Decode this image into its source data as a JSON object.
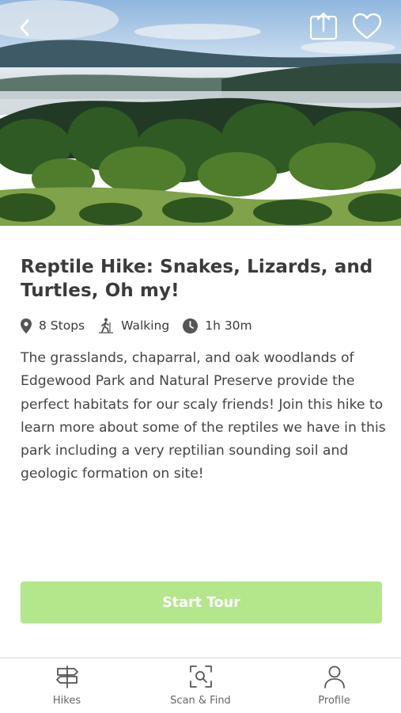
{
  "hero": {
    "back_icon": "chevron-left-icon",
    "share_icon": "share-icon",
    "favorite_icon": "heart-icon"
  },
  "tour": {
    "title": "Reptile Hike: Snakes, Lizards, and Turtles, Oh my!",
    "stops": "8 Stops",
    "mode": "Walking",
    "duration": "1h 30m",
    "description": "The grasslands, chaparral, and oak woodlands of Edgewood Park and Natural Preserve provide the perfect habitats for our scaly friends! Join this hike to learn more about some of the reptiles we have in this park including a very reptilian sounding soil and geologic formation on site!"
  },
  "start_button": {
    "label": "Start Tour",
    "color": "#b4e68c"
  },
  "nav": {
    "items": [
      {
        "label": "Hikes",
        "icon": "signpost-icon"
      },
      {
        "label": "Scan & Find",
        "icon": "scan-icon"
      },
      {
        "label": "Profile",
        "icon": "person-icon"
      }
    ]
  }
}
